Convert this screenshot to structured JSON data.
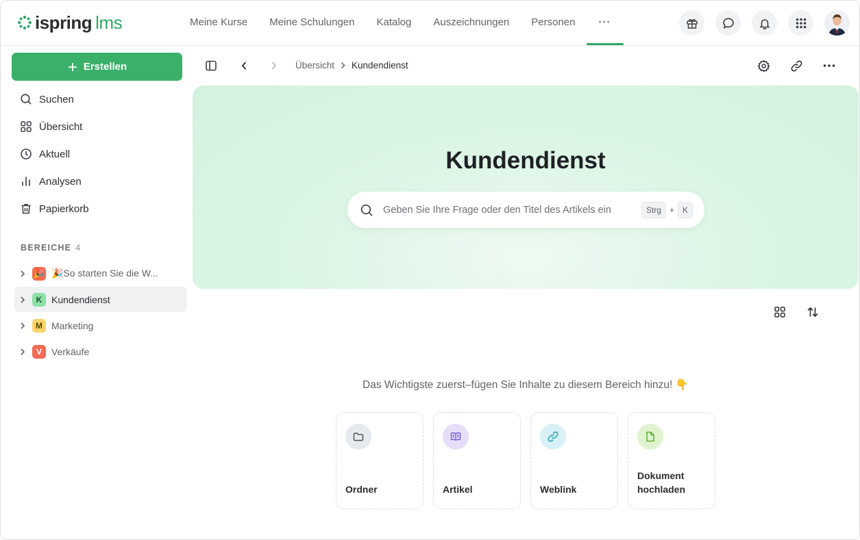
{
  "app": {
    "logo_main": "ispring",
    "logo_sub": "lms",
    "brand_color": "#3bb06a"
  },
  "nav": {
    "items": [
      "Meine Kurse",
      "Meine Schulungen",
      "Katalog",
      "Auszeichnungen",
      "Personen"
    ],
    "more_label": "···"
  },
  "top_icons": [
    "gift-icon",
    "chat-icon",
    "bell-icon",
    "apps-grid-icon"
  ],
  "sidebar": {
    "create_label": "Erstellen",
    "menu": [
      {
        "label": "Suchen",
        "icon": "search-icon"
      },
      {
        "label": "Übersicht",
        "icon": "grid-icon"
      },
      {
        "label": "Aktuell",
        "icon": "clock-icon"
      },
      {
        "label": "Analysen",
        "icon": "bar-chart-icon"
      },
      {
        "label": "Papierkorb",
        "icon": "trash-icon"
      }
    ],
    "section_title": "BEREICHE",
    "section_count": "4",
    "spaces": [
      {
        "badge": "🎉",
        "label": "🎉So starten Sie die W...",
        "color": "#f26b4f"
      },
      {
        "badge": "K",
        "label": "Kundendienst",
        "color": "#8de0a8",
        "active": true
      },
      {
        "badge": "M",
        "label": "Marketing",
        "color": "#f8d46a"
      },
      {
        "badge": "V",
        "label": "Verkäufe",
        "color": "#f06c55"
      }
    ]
  },
  "breadcrumb": {
    "parent": "Übersicht",
    "current": "Kundendienst"
  },
  "hero": {
    "title": "Kundendienst",
    "search_placeholder": "Geben Sie Ihre Frage oder den Titel des Artikels ein",
    "shortcut_key1": "Strg",
    "shortcut_plus": "+",
    "shortcut_key2": "K"
  },
  "content": {
    "empty_message": "Das Wichtigste zuerst–fügen Sie Inhalte zu diesem Bereich hinzu! 👇",
    "cards": [
      {
        "label": "Ordner",
        "icon": "folder-icon",
        "bg": "#e6e9ee"
      },
      {
        "label": "Artikel",
        "icon": "book-icon",
        "bg": "#e6def8"
      },
      {
        "label": "Weblink",
        "icon": "link-icon",
        "bg": "#d7f1f6"
      },
      {
        "label": "Dokument hochladen",
        "icon": "document-icon",
        "bg": "#dff3cf"
      }
    ]
  }
}
